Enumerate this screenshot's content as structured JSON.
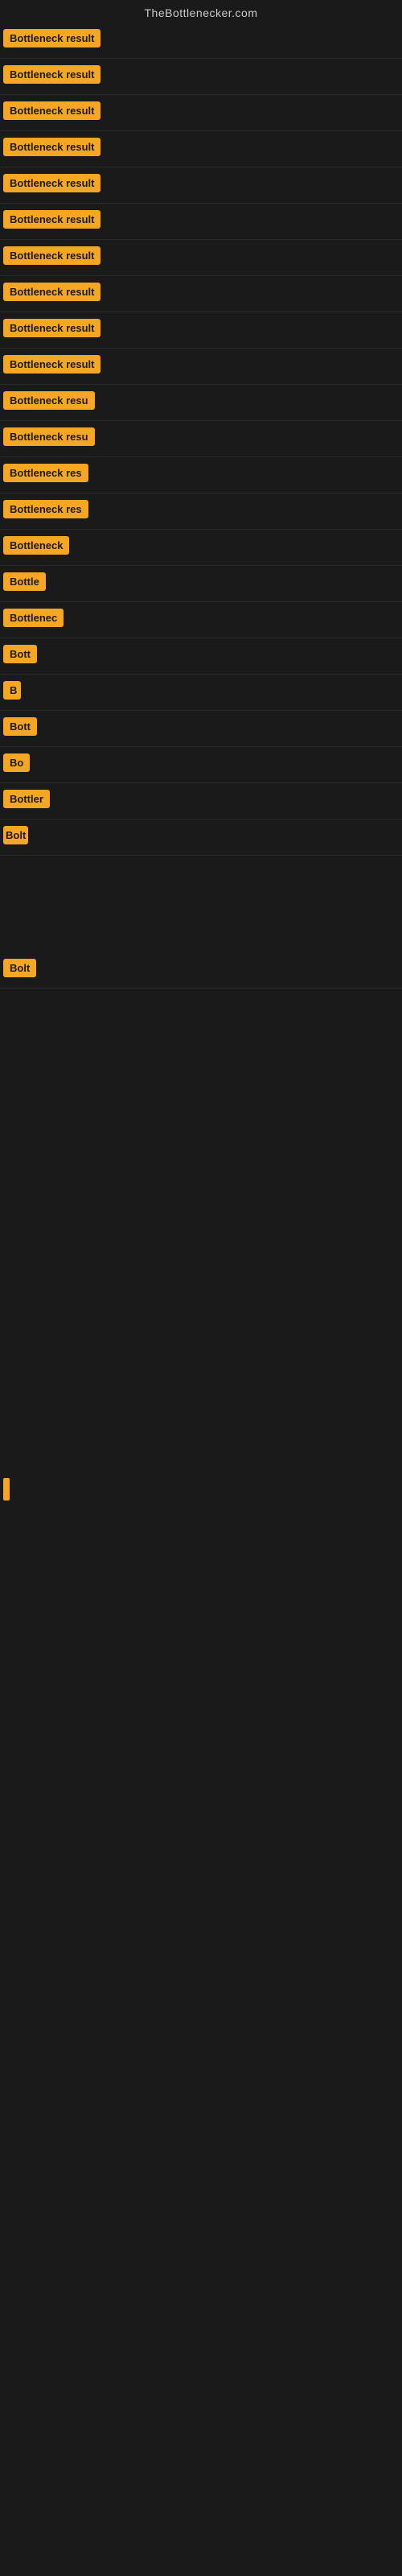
{
  "site": {
    "title": "TheBottlenecker.com"
  },
  "rows": [
    {
      "id": 1,
      "label": "Bottleneck result",
      "visible_text": "Bottleneck result"
    },
    {
      "id": 2,
      "label": "Bottleneck result",
      "visible_text": "Bottleneck result"
    },
    {
      "id": 3,
      "label": "Bottleneck result",
      "visible_text": "Bottleneck result"
    },
    {
      "id": 4,
      "label": "Bottleneck result",
      "visible_text": "Bottleneck result"
    },
    {
      "id": 5,
      "label": "Bottleneck result",
      "visible_text": "Bottleneck result"
    },
    {
      "id": 6,
      "label": "Bottleneck result",
      "visible_text": "Bottleneck result"
    },
    {
      "id": 7,
      "label": "Bottleneck result",
      "visible_text": "Bottleneck result"
    },
    {
      "id": 8,
      "label": "Bottleneck result",
      "visible_text": "Bottleneck result"
    },
    {
      "id": 9,
      "label": "Bottleneck result",
      "visible_text": "Bottleneck result"
    },
    {
      "id": 10,
      "label": "Bottleneck result",
      "visible_text": "Bottleneck result"
    },
    {
      "id": 11,
      "label": "Bottleneck resu",
      "visible_text": "Bottleneck resu"
    },
    {
      "id": 12,
      "label": "Bottleneck resu",
      "visible_text": "Bottleneck resu"
    },
    {
      "id": 13,
      "label": "Bottleneck res",
      "visible_text": "Bottleneck res"
    },
    {
      "id": 14,
      "label": "Bottleneck res",
      "visible_text": "Bottleneck res"
    },
    {
      "id": 15,
      "label": "Bottleneck",
      "visible_text": "Bottleneck"
    },
    {
      "id": 16,
      "label": "Bottle",
      "visible_text": "Bottle"
    },
    {
      "id": 17,
      "label": "Bottlenec",
      "visible_text": "Bottlenec"
    },
    {
      "id": 18,
      "label": "Bott",
      "visible_text": "Bott"
    },
    {
      "id": 19,
      "label": "B",
      "visible_text": "B"
    },
    {
      "id": 20,
      "label": "Bott",
      "visible_text": "Bott"
    },
    {
      "id": 21,
      "label": "Bo",
      "visible_text": "Bo"
    },
    {
      "id": 22,
      "label": "Bottler",
      "visible_text": "Bottler"
    },
    {
      "id": 23,
      "label": "Bolt",
      "visible_text": "Bolt"
    },
    {
      "id": 24,
      "label": "Bolt",
      "visible_text": "Bolt"
    }
  ],
  "colors": {
    "badge_bg": "#f5a623",
    "page_bg": "#1a1a1a",
    "title_color": "#cccccc",
    "badge_text": "#1a1a1a"
  }
}
